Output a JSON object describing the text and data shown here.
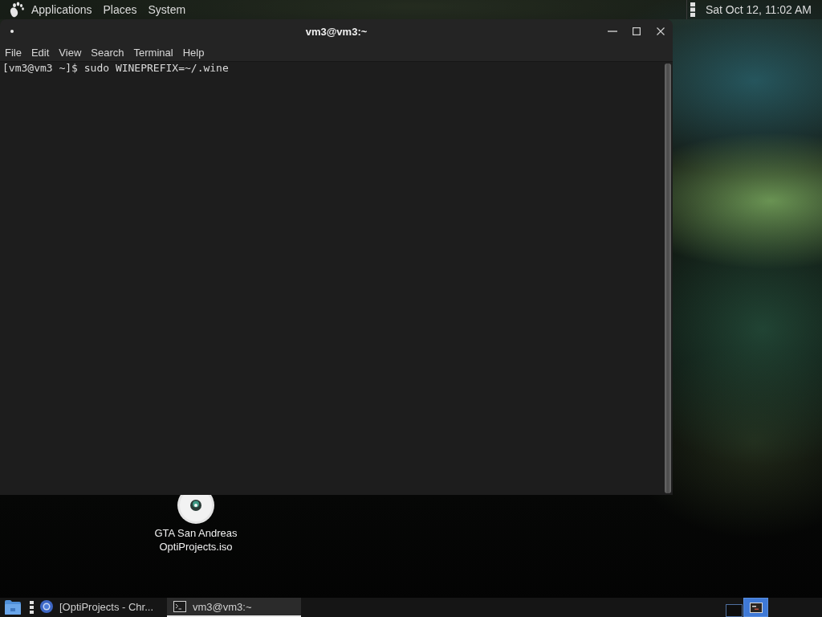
{
  "top_panel": {
    "menus": [
      "Applications",
      "Places",
      "System"
    ],
    "clock": "Sat Oct 12, 11:02 AM"
  },
  "terminal_window": {
    "title": "vm3@vm3:~",
    "menu": [
      "File",
      "Edit",
      "View",
      "Search",
      "Terminal",
      "Help"
    ],
    "lines": [
      "[vm3@vm3 ~]$ sudo WINEPREFIX=~/.wine"
    ]
  },
  "desktop_icons": [
    {
      "label": "GTA San Andreas OptiProjects.iso"
    }
  ],
  "taskbar": {
    "tasks": [
      {
        "kind": "browser",
        "label": "[OptiProjects - Chr...",
        "selected": false
      },
      {
        "kind": "terminal",
        "label": "vm3@vm3:~",
        "selected": true
      }
    ],
    "workspaces": [
      {
        "selected": false,
        "has_window": false
      },
      {
        "selected": true,
        "has_window": true
      }
    ]
  }
}
